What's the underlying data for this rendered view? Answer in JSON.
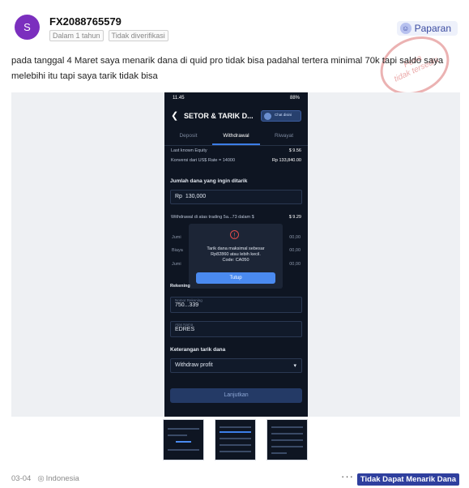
{
  "author": {
    "initial": "S",
    "username": "FX2088765579",
    "tags": [
      "Dalam 1 tahun",
      "Tidak diverifikasi"
    ]
  },
  "display_button": {
    "label": "Paparan",
    "icon": "face-icon"
  },
  "stamp": {
    "line1": "Pena",
    "line2": "tidak tersedia"
  },
  "post_text": "pada tanggal 4 Maret saya menarik dana di quid pro tidak bisa padahal tertera minimal 70k tapi saldo saya melebihi itu tapi saya tarik tidak bisa",
  "screenshot": {
    "status_time": "11.45",
    "status_right": "88%",
    "title": "SETOR & TARIK D...",
    "chat_label": "Chat disini",
    "tabs": [
      "Deposit",
      "Withdrawal",
      "Riwayat"
    ],
    "rows": [
      {
        "label": "Last known Equity",
        "value": "$ 9.56"
      },
      {
        "label": "Konversi dari US$ Rate = 14000",
        "value": "Rp 133,840.00"
      }
    ],
    "amount_label": "Jumlah dana yang ingin ditarik",
    "amount_prefix": "Rp",
    "amount_value": "130,000",
    "withdrawal_row": {
      "label": "Withdrawal di atas trading 5a...73 dalam $",
      "value": "$ 9.29"
    },
    "hidden_values": [
      "00,00",
      "00,00",
      "00,00"
    ],
    "hidden_labels": [
      "Jumi",
      "Biaya",
      "Jumi"
    ],
    "modal": {
      "message_line1": "Tarik dana maksimal sebesar",
      "message_line2": "Rp82860 atau lebih kecil.",
      "message_line3": "Code: CA050",
      "button": "Tutup"
    },
    "rekening_label": "Rekening",
    "account_number_label": "Nomor Rekening",
    "account_number": "750...339",
    "name_label": "Atas Nama",
    "name_value": "EDRES",
    "reason_label": "Keterangan tarik dana",
    "reason_value": "Withdraw profit",
    "submit": "Lanjutkan"
  },
  "footer": {
    "date": "03-04",
    "location": "Indonesia",
    "more": "···",
    "status_badge": "Tidak Dapat Menarik Dana"
  }
}
